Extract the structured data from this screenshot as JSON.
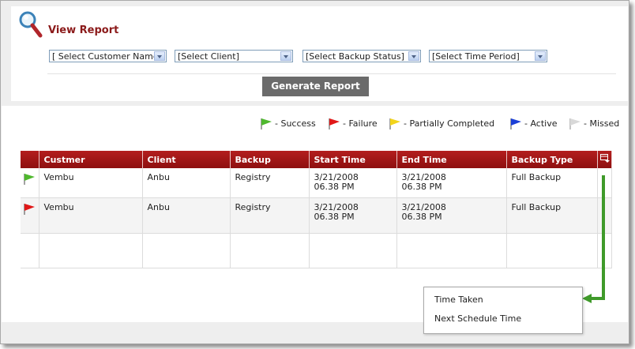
{
  "header": {
    "title": "View Report",
    "icon": "magnifier-icon"
  },
  "filters": {
    "customer": "[ Select Customer Name",
    "client": "[Select Client]",
    "backup_status": "[Select Backup Status]",
    "time_period": "[Select Time Period]"
  },
  "generate_label": "Generate Report",
  "legend": [
    {
      "label": "- Success",
      "color": "#4fb82e"
    },
    {
      "label": "- Failure",
      "color": "#e01818"
    },
    {
      "label": "- Partially Completed",
      "color": "#f2d41a"
    },
    {
      "label": "- Active",
      "color": "#1c3fd6"
    },
    {
      "label": "- Missed",
      "color": "#d8d8d8"
    }
  ],
  "table": {
    "columns": [
      "Custmer",
      "Client",
      "Backup",
      "Start Time",
      "End Time",
      "Backup Type"
    ],
    "rows": [
      {
        "flag_color": "#4fb82e",
        "customer": "Vembu",
        "client": "Anbu",
        "backup": "Registry",
        "start_date": "3/21/2008",
        "start_time": "06.38 PM",
        "end_date": "3/21/2008",
        "end_time": "06.38 PM",
        "type": "Full Backup"
      },
      {
        "flag_color": "#e01818",
        "customer": "Vembu",
        "client": "Anbu",
        "backup": "Registry",
        "start_date": "3/21/2008",
        "start_time": "06.38 PM",
        "end_date": "3/21/2008",
        "end_time": "06.38 PM",
        "type": "Full Backup"
      }
    ]
  },
  "column_menu": {
    "icon": "column-chooser-icon",
    "items": [
      "Time Taken",
      "Next Schedule Time"
    ]
  }
}
